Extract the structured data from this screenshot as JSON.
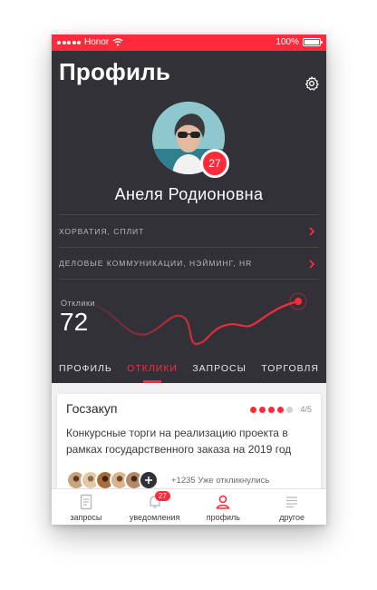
{
  "status_bar": {
    "carrier": "Honor",
    "battery": "100%"
  },
  "header": {
    "title": "Профиль"
  },
  "profile": {
    "name": "Анеля Родионовна",
    "badge_count": "27",
    "location": "ХОРВАТИЯ, СПЛИТ",
    "skills": "ДЕЛОВЫЕ КОММУНИКАЦИИ, НЭЙМИНГ, HR"
  },
  "stats": {
    "label": "Отклики",
    "value": "72"
  },
  "tabs": [
    {
      "label": "ПРОФИЛЬ",
      "active": false
    },
    {
      "label": "ОТКЛИКИ",
      "active": true
    },
    {
      "label": "ЗАПРОСЫ",
      "active": false
    },
    {
      "label": "ТОРГОВЛЯ",
      "active": false
    }
  ],
  "card": {
    "title": "Госзакуп",
    "rating": "4/5",
    "rating_value": 4,
    "rating_max": 5,
    "text": "Конкурсные торги на реализацию проекта в рамках государственного заказа на 2019 год",
    "responders_text": "+1235 Уже откликнулись"
  },
  "tabbar": [
    {
      "label": "запросы",
      "icon": "document-icon"
    },
    {
      "label": "уведомления",
      "icon": "bell-icon",
      "badge": "27"
    },
    {
      "label": "профиль",
      "icon": "user-icon",
      "active": true
    },
    {
      "label": "другое",
      "icon": "menu-lines-icon"
    }
  ],
  "colors": {
    "accent": "#ff2a3a",
    "header_bg": "#323137",
    "card_bg": "#ffffff"
  }
}
